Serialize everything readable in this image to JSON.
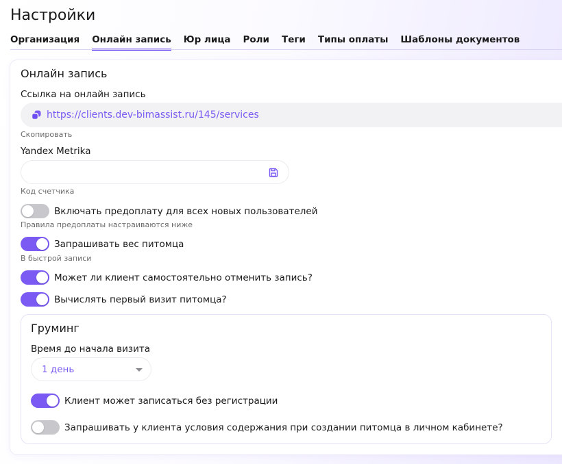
{
  "page": {
    "title": "Настройки"
  },
  "tabs": [
    {
      "label": "Организация"
    },
    {
      "label": "Онлайн запись",
      "active": true
    },
    {
      "label": "Юр лица"
    },
    {
      "label": "Роли"
    },
    {
      "label": "Теги"
    },
    {
      "label": "Типы оплаты"
    },
    {
      "label": "Шаблоны документов"
    }
  ],
  "online_booking": {
    "title": "Онлайн запись",
    "link_label": "Ссылка на онлайн запись",
    "link_url": "https://clients.dev-bimassist.ru/145/services",
    "link_icon": "copy-link-icon",
    "copy_hint": "Скопировать",
    "metrika_label": "Yandex Metrika",
    "metrika_value": "",
    "metrika_placeholder": "",
    "metrika_hint": "Код счетчика",
    "save_icon": "save-icon",
    "toggles": [
      {
        "label": "Включать предоплату для всех новых пользователей",
        "on": false,
        "hint": "Правила предоплаты настраиваются ниже"
      },
      {
        "label": "Запрашивать вес питомца",
        "on": true,
        "hint": "В быстрой записи"
      },
      {
        "label": "Может ли клиент самостоятельно отменить запись?",
        "on": true
      },
      {
        "label": "Вычислять первый визит питомца?",
        "on": true
      }
    ]
  },
  "grooming": {
    "title": "Груминг",
    "time_label": "Время до начала визита",
    "time_value": "1 день",
    "toggles": [
      {
        "label": "Клиент может записаться без регистрации",
        "on": true
      },
      {
        "label": "Запрашивать у клиента условия содержания при создании питомца в личном кабинете?",
        "on": false
      }
    ]
  },
  "colors": {
    "accent": "#7a5af2",
    "toggle_off": "#c8c8cc",
    "field_bg": "#f2f2f4"
  }
}
